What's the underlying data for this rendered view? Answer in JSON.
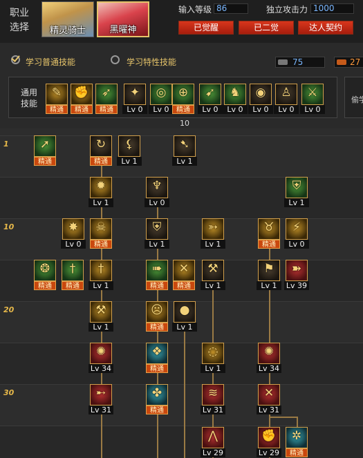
{
  "header": {
    "job_select_label": "职业选择",
    "jobs": [
      {
        "name": "精灵骑士",
        "selected": false
      },
      {
        "name": "黑曜神",
        "selected": true
      }
    ],
    "level_label": "输入等级",
    "level_value": "86",
    "attack_label": "独立攻击力",
    "attack_value": "1000",
    "buttons": [
      "已觉醒",
      "已二觉",
      "达人契约"
    ]
  },
  "tabs": {
    "normal_label": "学习普通技能",
    "normal_checked": true,
    "trait_label": "学习特性技能",
    "trait_checked": false,
    "sp_value": "75",
    "tp_value": "27"
  },
  "common": {
    "label": "通用技能",
    "steal_label": "偷学",
    "counter_value": "10",
    "skills": [
      {
        "icon": "book-icon",
        "state": "mastered"
      },
      {
        "icon": "fist-icon",
        "state": "mastered"
      },
      {
        "icon": "run-icon",
        "state": "mastered"
      },
      {
        "icon": "wings-icon",
        "level": "Lv 0"
      },
      {
        "icon": "target-icon",
        "level": "Lv 0"
      },
      {
        "icon": "crosshair-icon",
        "state": "mastered"
      },
      {
        "icon": "kick-icon",
        "level": "Lv 0"
      },
      {
        "icon": "figure-icon",
        "level": "Lv 0"
      },
      {
        "icon": "eye-icon",
        "level": "Lv 0"
      },
      {
        "icon": "person-icon",
        "level": "Lv 0"
      },
      {
        "icon": "blade-icon",
        "level": "Lv 0"
      }
    ],
    "mastered_text": "精通"
  },
  "tree": {
    "row_markers": [
      "1",
      "10",
      "20",
      "30"
    ],
    "mastered_text": "精通",
    "skills": [
      {
        "id": "s1",
        "icon": "spear-icon",
        "color": "green",
        "state": "mastered"
      },
      {
        "id": "s2",
        "icon": "whirl-icon",
        "color": "dark",
        "state": "mastered"
      },
      {
        "id": "s3",
        "icon": "claw-icon",
        "color": "dark",
        "level": "Lv 1"
      },
      {
        "id": "s4",
        "icon": "boot-icon",
        "color": "dark",
        "level": "Lv 1"
      },
      {
        "id": "s5",
        "icon": "gear-icon",
        "color": "gold",
        "level": "Lv 1"
      },
      {
        "id": "s6",
        "icon": "cup-icon",
        "color": "dark",
        "level": "Lv 0"
      },
      {
        "id": "s7",
        "icon": "shield-icon",
        "color": "green",
        "level": "Lv 1"
      },
      {
        "id": "s8",
        "icon": "burst-icon",
        "color": "gold",
        "level": "Lv 0"
      },
      {
        "id": "s9",
        "icon": "skull-icon",
        "color": "gold",
        "state": "mastered"
      },
      {
        "id": "s10",
        "icon": "shield-icon",
        "color": "dark",
        "level": "Lv 1"
      },
      {
        "id": "s11",
        "icon": "rays-icon",
        "color": "gold",
        "level": "Lv 1"
      },
      {
        "id": "s12",
        "icon": "beast-icon",
        "color": "gold",
        "state": "mastered"
      },
      {
        "id": "s13",
        "icon": "slash-icon",
        "color": "gold",
        "level": "Lv 0"
      },
      {
        "id": "s14",
        "icon": "rune-icon",
        "color": "green",
        "state": "mastered"
      },
      {
        "id": "s15",
        "icon": "sword-icon",
        "color": "green",
        "state": "mastered"
      },
      {
        "id": "s16",
        "icon": "sword-icon",
        "color": "gold",
        "level": "Lv 1"
      },
      {
        "id": "s17",
        "icon": "dash-icon",
        "color": "green",
        "state": "mastered"
      },
      {
        "id": "s18",
        "icon": "cross-icon",
        "color": "gold",
        "state": "mastered"
      },
      {
        "id": "s19",
        "icon": "axe-icon",
        "color": "dark",
        "level": "Lv 1"
      },
      {
        "id": "s20",
        "icon": "hammer-icon",
        "color": "dark",
        "level": "Lv 1"
      },
      {
        "id": "s21",
        "icon": "bow-icon",
        "color": "red",
        "level": "Lv 39"
      },
      {
        "id": "s22",
        "icon": "axe-icon",
        "color": "gold",
        "level": "Lv 1"
      },
      {
        "id": "s23",
        "icon": "face-icon",
        "color": "gold",
        "state": "mastered"
      },
      {
        "id": "s24",
        "icon": "bomb-icon",
        "color": "dark",
        "level": "Lv 1"
      },
      {
        "id": "s25",
        "icon": "flame-icon",
        "color": "red",
        "level": "Lv 34"
      },
      {
        "id": "s26",
        "icon": "teeth-icon",
        "color": "teal",
        "state": "mastered"
      },
      {
        "id": "s27",
        "icon": "ring-icon",
        "color": "gold",
        "level": "Lv 1"
      },
      {
        "id": "s28",
        "icon": "flame-icon",
        "color": "red",
        "level": "Lv 34"
      },
      {
        "id": "s29",
        "icon": "leap-icon",
        "color": "red",
        "level": "Lv 31"
      },
      {
        "id": "s30",
        "icon": "orb-icon",
        "color": "teal",
        "state": "mastered"
      },
      {
        "id": "s31",
        "icon": "wave-icon",
        "color": "red",
        "level": "Lv 31"
      },
      {
        "id": "s32",
        "icon": "cross-icon",
        "color": "red",
        "level": "Lv 31"
      },
      {
        "id": "s33",
        "icon": "spike-icon",
        "color": "red",
        "level": "Lv 29"
      },
      {
        "id": "s34",
        "icon": "fist-icon",
        "color": "red",
        "level": "Lv 29"
      },
      {
        "id": "s35",
        "icon": "vortex-icon",
        "color": "teal",
        "state": "mastered"
      }
    ]
  },
  "colors": {
    "accent": "#e6c46a",
    "button_red": "#d8361c",
    "mastered_orange": "#c9480e",
    "link_blue": "#7ab7ff",
    "tp_orange": "#ff9a3c"
  }
}
